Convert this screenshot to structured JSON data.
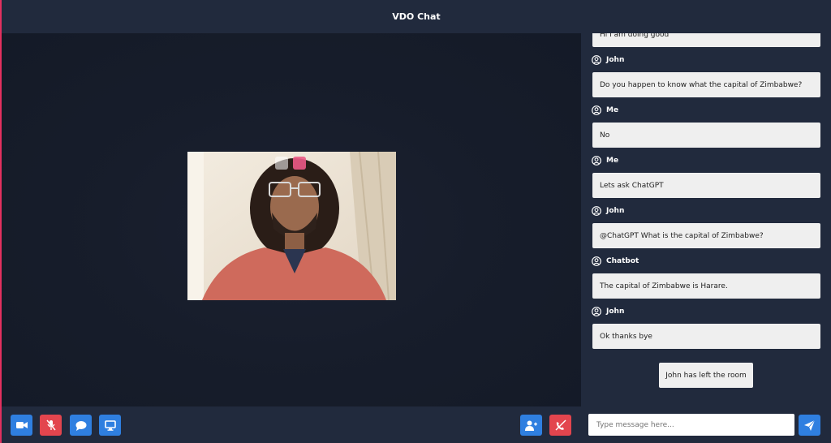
{
  "app": {
    "title": "VDO Chat"
  },
  "colors": {
    "accent": "#2f7fe0",
    "danger": "#e3454e",
    "panel": "#212a3d",
    "stage": "#141a28",
    "bubble": "#efefef"
  },
  "video": {
    "participant_icons": [
      "camera-off-icon",
      "mic-off-icon"
    ]
  },
  "controls": {
    "left": [
      {
        "name": "camera-toggle-button",
        "icon": "video-camera-icon",
        "color": "blue"
      },
      {
        "name": "mic-toggle-button",
        "icon": "mic-off-icon",
        "color": "red"
      },
      {
        "name": "chat-toggle-button",
        "icon": "chat-bubble-icon",
        "color": "blue"
      },
      {
        "name": "screen-share-button",
        "icon": "monitor-icon",
        "color": "blue"
      }
    ],
    "right": [
      {
        "name": "add-user-button",
        "icon": "add-user-icon",
        "color": "blue"
      },
      {
        "name": "leave-call-button",
        "icon": "hang-up-icon",
        "color": "red"
      }
    ]
  },
  "chat": {
    "messages": [
      {
        "text": "Hi I am doing good"
      },
      {
        "sender": "John",
        "text": "Do you happen to know what the capital of Zimbabwe?"
      },
      {
        "sender": "Me",
        "text": "No"
      },
      {
        "sender": "Me",
        "text": "Lets ask ChatGPT"
      },
      {
        "sender": "John",
        "text": "@ChatGPT What is the capital of Zimbabwe?"
      },
      {
        "sender": "Chatbot",
        "text": "The capital of Zimbabwe is Harare."
      },
      {
        "sender": "John",
        "text": "Ok thanks bye"
      }
    ],
    "system_note": "John has left the room"
  },
  "composer": {
    "placeholder": "Type message here...",
    "value": ""
  }
}
